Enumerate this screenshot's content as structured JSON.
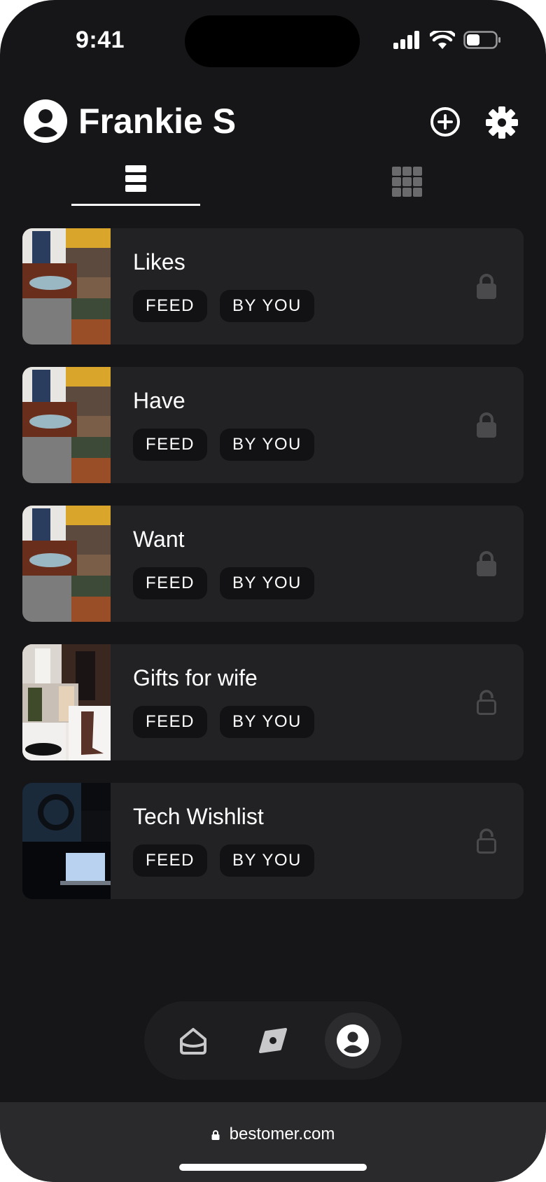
{
  "status_bar": {
    "time": "9:41"
  },
  "header": {
    "username": "Frankie S"
  },
  "lists": [
    {
      "title": "Likes",
      "tags": [
        "FEED",
        "BY YOU"
      ],
      "privacy": "locked"
    },
    {
      "title": "Have",
      "tags": [
        "FEED",
        "BY YOU"
      ],
      "privacy": "locked"
    },
    {
      "title": "Want",
      "tags": [
        "FEED",
        "BY YOU"
      ],
      "privacy": "locked"
    },
    {
      "title": "Gifts for wife",
      "tags": [
        "FEED",
        "BY YOU"
      ],
      "privacy": "unlocked"
    },
    {
      "title": "Tech Wishlist",
      "tags": [
        "FEED",
        "BY YOU"
      ],
      "privacy": "unlocked"
    }
  ],
  "browser": {
    "url": "bestomer.com"
  },
  "colors": {
    "background": "#161618",
    "card": "#222224",
    "tag": "#121214",
    "lock": "#4a4a4c"
  }
}
